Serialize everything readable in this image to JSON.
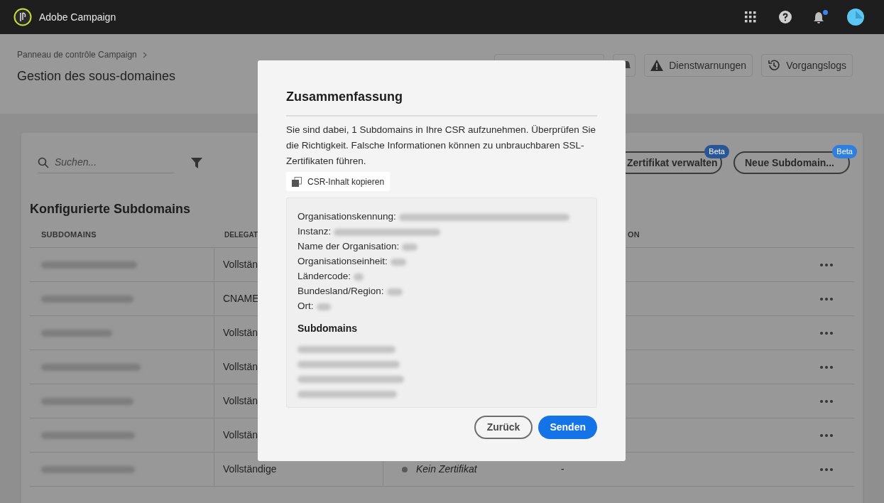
{
  "app": {
    "name": "Adobe Campaign",
    "notification_unread": true
  },
  "breadcrumb": "Panneau de contrôle Campaign",
  "page_title": "Gestion des sous-domaines",
  "header_buttons": [
    {
      "kind": "covered"
    },
    {
      "kind": "icon"
    },
    {
      "kind": "warning",
      "label": "Dienstwarnungen"
    },
    {
      "kind": "history",
      "label": "Vorgangslogs"
    }
  ],
  "search": {
    "placeholder": "Suchen..."
  },
  "actions": [
    {
      "label": "Zertifikat verwalten",
      "badge": "Beta",
      "color": "#2a5596"
    },
    {
      "label": "Neue Subdomain...",
      "badge": "Beta",
      "color": "#2f7fe0"
    }
  ],
  "section_title": "Konfigurierte Subdomains",
  "table": {
    "columns": [
      {
        "label": "SUBDOMAINS"
      },
      {
        "label": "DELEGAT"
      },
      {
        "label": "ON"
      }
    ],
    "rows": [
      {
        "delegation": "Vollstän"
      },
      {
        "delegation": "CNAME"
      },
      {
        "delegation": "Vollstän"
      },
      {
        "delegation": "Vollstän"
      },
      {
        "delegation": "Vollstän"
      },
      {
        "delegation": "Vollstän"
      },
      {
        "delegation": "Vollständige",
        "status": "Kein Zertifikat",
        "column_4": "-"
      }
    ]
  },
  "dialog": {
    "title": "Zusammenfassung",
    "message": "Sie sind dabei, 1 Subdomains in Ihre CSR aufzunehmen. Überprüfen Sie die Richtigkeit. Falsche Informationen können zu unbrauchbaren SSL-Zertifikaten führen.",
    "copy_button": "CSR-Inhalt kopieren",
    "details": [
      {
        "label": "Organisationskennung:"
      },
      {
        "label": "Instanz:"
      },
      {
        "label": "Name der Organisation:"
      },
      {
        "label": "Organisationseinheit:"
      },
      {
        "label": "Ländercode:"
      },
      {
        "label": "Bundesland/Region:"
      },
      {
        "label": "Ort:"
      }
    ],
    "subdomains_heading": "Subdomains",
    "subdomains": [
      {
        "kind": "blurred"
      },
      {
        "kind": "blurred"
      },
      {
        "kind": "blurred"
      },
      {
        "kind": "blurred"
      }
    ],
    "buttons": [
      {
        "kind": "secondary",
        "label": "Zurück"
      },
      {
        "kind": "primary",
        "label": "Senden"
      }
    ]
  }
}
